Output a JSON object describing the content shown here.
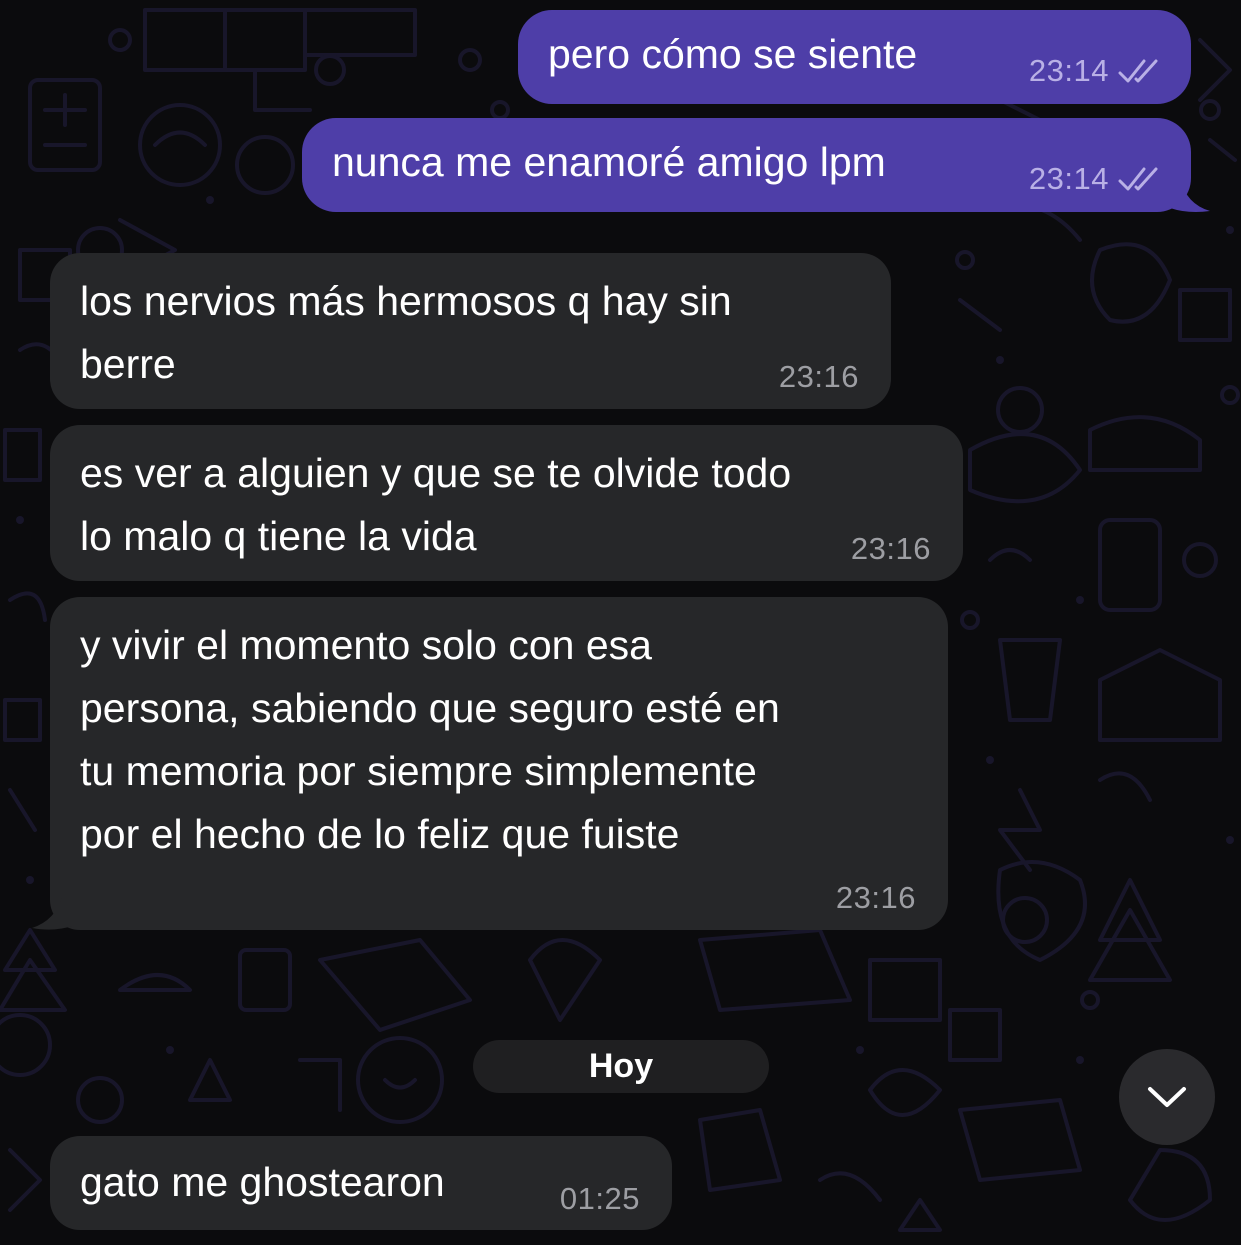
{
  "messages": [
    {
      "direction": "outgoing",
      "text": "pero cómo se siente",
      "time": "23:14",
      "status": "double-check-icon"
    },
    {
      "direction": "outgoing",
      "text": "nunca me enamoré amigo lpm",
      "time": "23:14",
      "status": "double-check-icon"
    },
    {
      "direction": "incoming",
      "text": "los nervios más hermosos q hay sin\nberre",
      "time": "23:16"
    },
    {
      "direction": "incoming",
      "text": "es ver a alguien y que se te olvide todo\nlo malo q tiene la vida",
      "time": "23:16"
    },
    {
      "direction": "incoming",
      "text": "y vivir el momento solo con esa\npersona, sabiendo que seguro esté en\ntu memoria por siempre simplemente\npor el hecho de lo feliz que fuiste",
      "time": "23:16"
    },
    {
      "direction": "incoming",
      "text": "gato me ghostearon",
      "time": "01:25"
    }
  ],
  "date_separator": "Hoy",
  "scroll_button_icon": "chevron-down-icon",
  "colors": {
    "outgoing_bubble": "#4e3ea8",
    "incoming_bubble": "#262729",
    "background": "#0b0b0d",
    "wallpaper_lines": "#231f42"
  }
}
